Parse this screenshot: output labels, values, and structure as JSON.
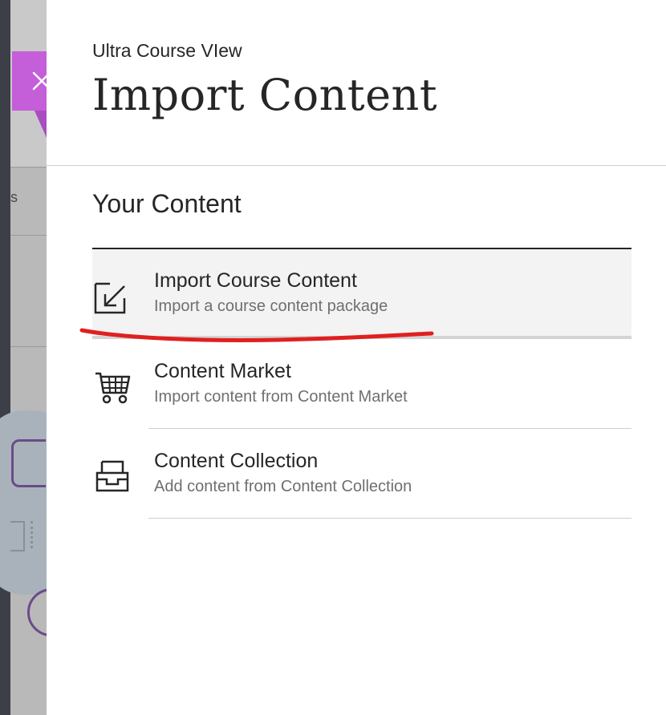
{
  "header": {
    "subtitle": "Ultra Course VIew",
    "title": "Import Content"
  },
  "section": {
    "title": "Your Content"
  },
  "items": [
    {
      "title": "Import Course Content",
      "description": "Import a course content package",
      "icon": "import-arrow-icon",
      "state": "highlighted"
    },
    {
      "title": "Content Market",
      "description": "Import content from Content Market",
      "icon": "shopping-cart-icon"
    },
    {
      "title": "Content Collection",
      "description": "Add content from Content Collection",
      "icon": "inbox-tray-icon"
    }
  ],
  "background": {
    "fragment_text": "s"
  },
  "colors": {
    "close_flag": "#c45ed9",
    "annotation": "#e02020",
    "text": "#262626",
    "secondary_text": "#6f6f6f"
  }
}
